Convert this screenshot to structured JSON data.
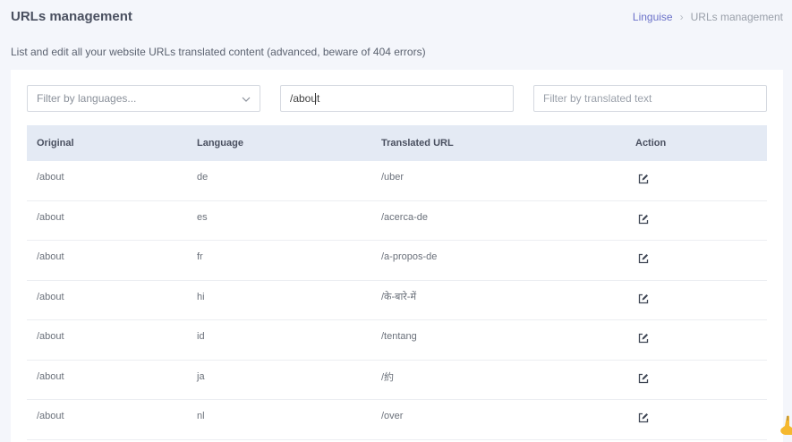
{
  "header": {
    "title": "URLs management",
    "breadcrumb": {
      "link": "Linguise",
      "separator": "›",
      "current": "URLs management"
    },
    "subtitle": "List and edit all your website URLs translated content (advanced, beware of 404 errors)"
  },
  "filters": {
    "languages_placeholder": "Filter by languages...",
    "original_value": "/about",
    "translated_placeholder": "Filter by translated text"
  },
  "table": {
    "columns": [
      "Original",
      "Language",
      "Translated URL",
      "Action"
    ],
    "rows": [
      {
        "original": "/about",
        "language": "de",
        "translated": "/uber"
      },
      {
        "original": "/about",
        "language": "es",
        "translated": "/acerca-de"
      },
      {
        "original": "/about",
        "language": "fr",
        "translated": "/a-propos-de"
      },
      {
        "original": "/about",
        "language": "hi",
        "translated": "/के-बारे-में"
      },
      {
        "original": "/about",
        "language": "id",
        "translated": "/tentang"
      },
      {
        "original": "/about",
        "language": "ja",
        "translated": "/約"
      },
      {
        "original": "/about",
        "language": "nl",
        "translated": "/over"
      }
    ]
  },
  "icons": {
    "action": "edit-icon",
    "select_arrow": "chevron-down-icon"
  },
  "colors": {
    "accent": "#6b72c9",
    "header_bg": "#e4eaf4",
    "page_bg": "#f4f6fb"
  }
}
